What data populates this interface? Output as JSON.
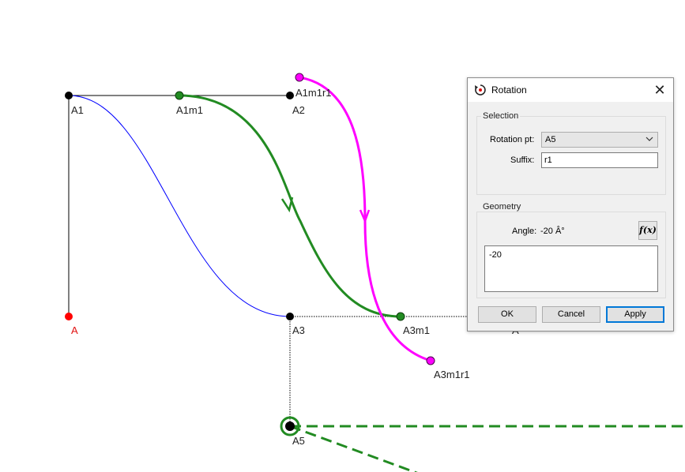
{
  "canvas": {
    "points": {
      "A": "A",
      "A1": "A1",
      "A2": "A2",
      "A3": "A3",
      "A5": "A5",
      "A4_partial": "A",
      "A1m1": "A1m1",
      "A3m1": "A3m1",
      "A1m1r1": "A1m1r1",
      "A3m1r1": "A3m1r1"
    },
    "colors": {
      "base_curve": "#0000ff",
      "mirrored_curve": "#228b22",
      "rotated_curve": "#ff00ff",
      "point": "#000000",
      "point_A": "#ff0000"
    }
  },
  "dialog": {
    "title": "Rotation",
    "close_icon": "close-icon",
    "selection": {
      "group_title": "Selection",
      "rotation_pt_label": "Rotation pt:",
      "rotation_pt_value": "A5",
      "suffix_label": "Suffix:",
      "suffix_value": "r1"
    },
    "geometry": {
      "group_title": "Geometry",
      "angle_label": "Angle:",
      "angle_value": "-20 Â°",
      "formula_button": "f(x)",
      "formula_text": "-20"
    },
    "buttons": {
      "ok": "OK",
      "cancel": "Cancel",
      "apply": "Apply"
    }
  }
}
